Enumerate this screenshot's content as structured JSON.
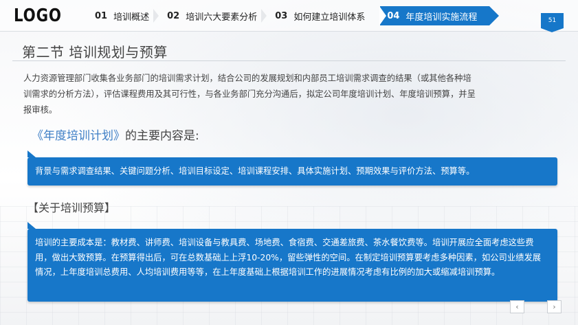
{
  "header": {
    "logo": "LOGO",
    "nav": [
      {
        "num": "01",
        "label": "培训概述"
      },
      {
        "num": "02",
        "label": "培训六大要素分析"
      },
      {
        "num": "03",
        "label": "如何建立培训体系"
      },
      {
        "num": "04",
        "label": "年度培训实施流程"
      }
    ],
    "active_index": 3,
    "page_number": "51"
  },
  "section_title": "第二节  培训规划与预算",
  "intro_text": "人力资源管理部门收集各业务部门的培训需求计划，结合公司的发展规划和内部员工培训需求调查的结果（或其他各种培训需求的分析方法），评估课程费用及其可行性，与各业务部门充分沟通后，拟定公司年度培训计划、年度培训预算，并呈报审核。",
  "plan": {
    "heading_accent": "《年度培训计划》",
    "heading_rest": "的主要内容是:",
    "content": "背景与需求调查结果、关键问题分析、培训目标设定、培训课程安排、具体实施计划、预期效果与评价方法、预算等。"
  },
  "budget": {
    "heading": "【关于培训预算】",
    "content": "培训的主要成本是：教材费、讲师费、培训设备与教具费、场地费、食宿费、交通差旅费、茶水餐饮费等。培训开展应全面考虑这些费用，做出大致预算。在预算得出后，可在总数基础上上浮10-20%，留些弹性的空间。在制定培训预算要考虑多种因素，如公司业绩发展情况，上年度培训总费用、人均培训费用等等，在上年度基础上根据培训工作的进展情况考虑有比例的加大或缩减培训预算。"
  },
  "controls": {
    "prev_glyph": "‹",
    "next_glyph": "›"
  },
  "colors": {
    "accent": "#1677c9",
    "heading_accent": "#3f7fc6"
  }
}
